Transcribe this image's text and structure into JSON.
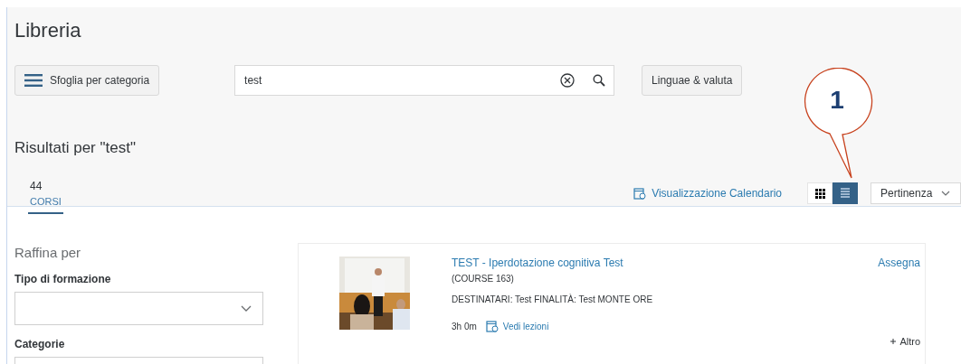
{
  "page": {
    "title": "Libreria"
  },
  "browse_button": {
    "label": "Sfoglia per categoria"
  },
  "search": {
    "value": "test"
  },
  "language_button": {
    "label": "Linguae & valuta"
  },
  "results_title": "Risultati per \"test\"",
  "tabs": [
    {
      "count": "44",
      "label": "CORSI",
      "selected": true
    }
  ],
  "calendar_link": "Visualizzazione Calendario",
  "view_toggle": [
    {
      "kind": "grid",
      "selected": false
    },
    {
      "kind": "list",
      "selected": true
    }
  ],
  "sort": {
    "value": "Pertinenza"
  },
  "callout": {
    "label": "1"
  },
  "filters": {
    "title": "Raffina per",
    "groups": [
      {
        "label": "Tipo di formazione"
      },
      {
        "label": "Categorie"
      }
    ]
  },
  "courses": [
    {
      "title": "TEST - Iperdotazione cognitiva Test",
      "code": "(COURSE 163)",
      "description": "DESTINATARI: Test FINALITÀ: Test MONTE ORE",
      "duration": "3h 0m",
      "lessons_link": "Vedi lezioni",
      "action": "Assegna",
      "more": "Altro"
    }
  ]
}
